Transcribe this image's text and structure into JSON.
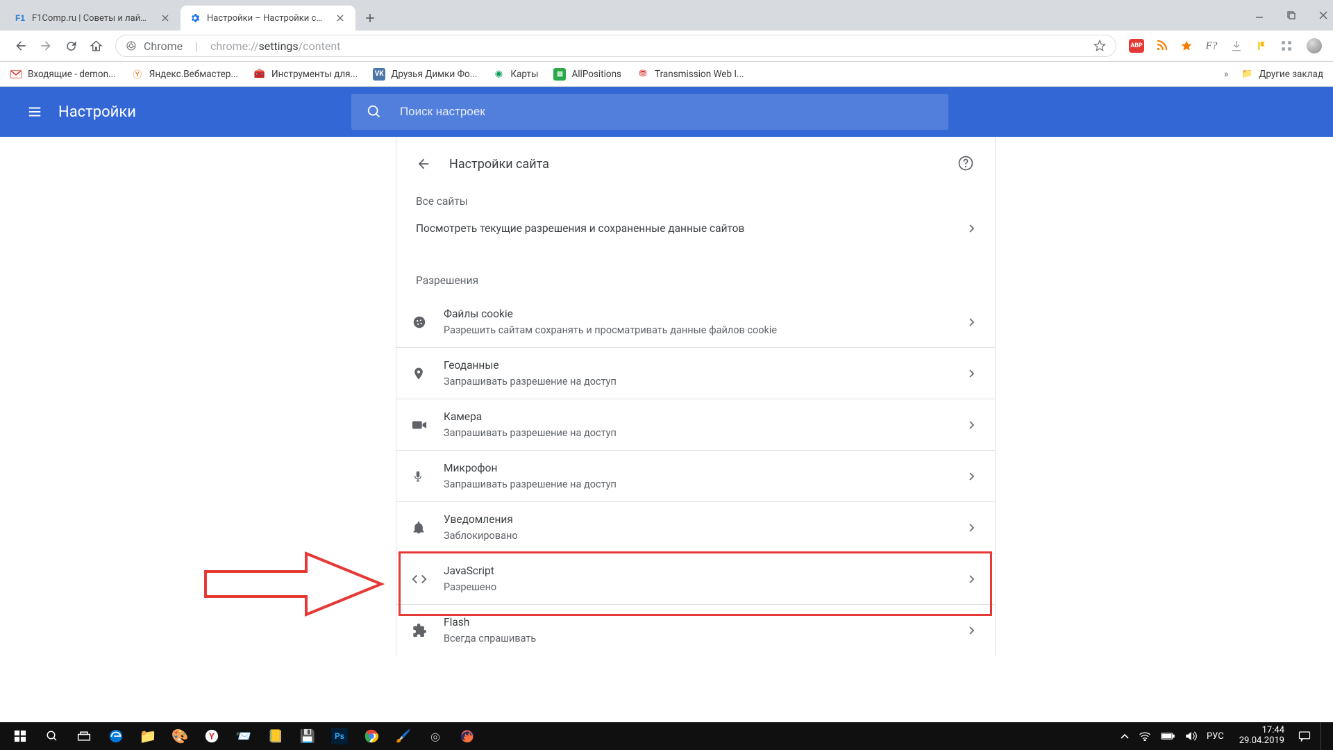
{
  "browser_tabs": [
    {
      "title": "F1Comp.ru | Советы и лайфхаки",
      "favicon_text": "F1",
      "favicon_color": "#2a7fd4"
    },
    {
      "title": "Настройки – Настройки сайта",
      "favicon_text": "⚙",
      "favicon_color": "#1a73e8"
    }
  ],
  "omnibox": {
    "scheme_label": "Chrome",
    "url_rest_pre": "chrome://",
    "url_bold": "settings",
    "url_rest_post": "/content"
  },
  "bookmarks": [
    {
      "label": "Входящие - demon...",
      "icon": "gmail"
    },
    {
      "label": "Яндекс.Вебмастер...",
      "icon": "yandex"
    },
    {
      "label": "Инструменты для...",
      "icon": "tools"
    },
    {
      "label": "Друзья Димки Фо...",
      "icon": "vk"
    },
    {
      "label": "Карты",
      "icon": "maps"
    },
    {
      "label": "AllPositions",
      "icon": "allpos"
    },
    {
      "label": "Transmission Web I...",
      "icon": "trans"
    }
  ],
  "bookmarks_right": {
    "label": "Другие заклад"
  },
  "header": {
    "title": "Настройки"
  },
  "search": {
    "placeholder": "Поиск настроек"
  },
  "page": {
    "title": "Настройки сайта",
    "section_all_sites": "Все сайты",
    "view_permissions": "Посмотреть текущие разрешения и сохраненные данные сайтов",
    "section_permissions": "Разрешения",
    "items": [
      {
        "icon": "cookie",
        "title": "Файлы cookie",
        "sub": "Разрешить сайтам сохранять и просматривать данные файлов cookie"
      },
      {
        "icon": "location",
        "title": "Геоданные",
        "sub": "Запрашивать разрешение на доступ"
      },
      {
        "icon": "camera",
        "title": "Камера",
        "sub": "Запрашивать разрешение на доступ"
      },
      {
        "icon": "mic",
        "title": "Микрофон",
        "sub": "Запрашивать разрешение на доступ"
      },
      {
        "icon": "bell",
        "title": "Уведомления",
        "sub": "Заблокировано"
      },
      {
        "icon": "code",
        "title": "JavaScript",
        "sub": "Разрешено"
      },
      {
        "icon": "puzzle",
        "title": "Flash",
        "sub": "Всегда спрашивать"
      }
    ]
  },
  "tray": {
    "lang": "РУС",
    "time": "17:44",
    "date": "29.04.2019"
  }
}
